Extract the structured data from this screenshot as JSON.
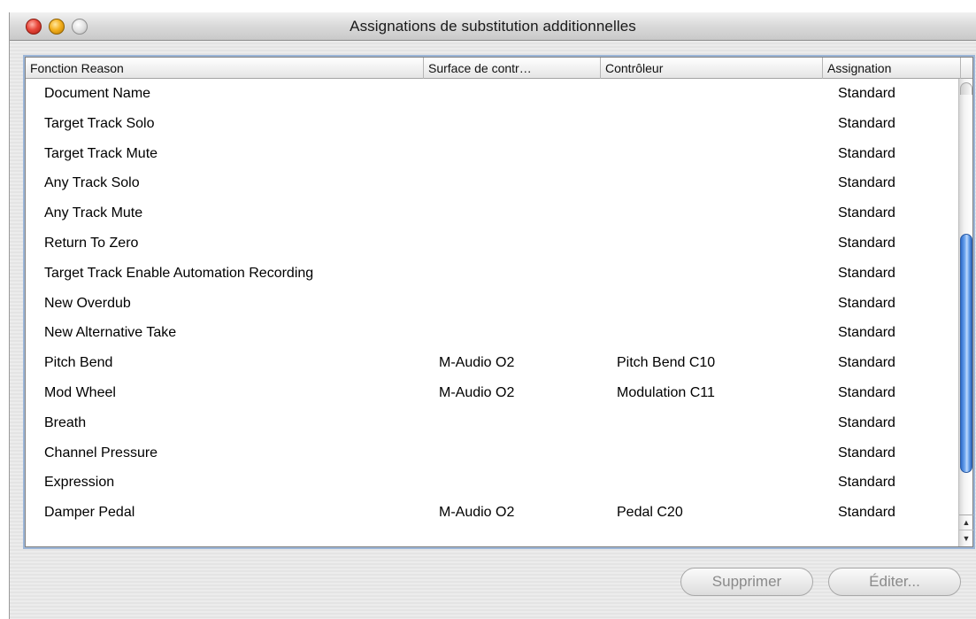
{
  "window": {
    "title": "Assignations de substitution additionnelles"
  },
  "table": {
    "columns": [
      "Fonction Reason",
      "Surface de contr…",
      "Contrôleur",
      "Assignation"
    ],
    "rows": [
      {
        "function": "Document Name",
        "surface": "",
        "controller": "",
        "assignment": "Standard"
      },
      {
        "function": "Target Track Solo",
        "surface": "",
        "controller": "",
        "assignment": "Standard"
      },
      {
        "function": "Target Track Mute",
        "surface": "",
        "controller": "",
        "assignment": "Standard"
      },
      {
        "function": "Any Track Solo",
        "surface": "",
        "controller": "",
        "assignment": "Standard"
      },
      {
        "function": "Any Track Mute",
        "surface": "",
        "controller": "",
        "assignment": "Standard"
      },
      {
        "function": "Return To Zero",
        "surface": "",
        "controller": "",
        "assignment": "Standard"
      },
      {
        "function": "Target Track Enable Automation Recording",
        "surface": "",
        "controller": "",
        "assignment": "Standard"
      },
      {
        "function": "New Overdub",
        "surface": "",
        "controller": "",
        "assignment": "Standard"
      },
      {
        "function": "New Alternative Take",
        "surface": "",
        "controller": "",
        "assignment": "Standard"
      },
      {
        "function": "Pitch Bend",
        "surface": "M-Audio O2",
        "controller": "Pitch Bend C10",
        "assignment": "Standard"
      },
      {
        "function": "Mod Wheel",
        "surface": "M-Audio O2",
        "controller": "Modulation C11",
        "assignment": "Standard"
      },
      {
        "function": "Breath",
        "surface": "",
        "controller": "",
        "assignment": "Standard"
      },
      {
        "function": "Channel Pressure",
        "surface": "",
        "controller": "",
        "assignment": "Standard"
      },
      {
        "function": "Expression",
        "surface": "",
        "controller": "",
        "assignment": "Standard"
      },
      {
        "function": "Damper Pedal",
        "surface": "M-Audio O2",
        "controller": "Pedal C20",
        "assignment": "Standard"
      }
    ]
  },
  "buttons": {
    "delete_label": "Supprimer",
    "edit_label": "Éditer..."
  }
}
